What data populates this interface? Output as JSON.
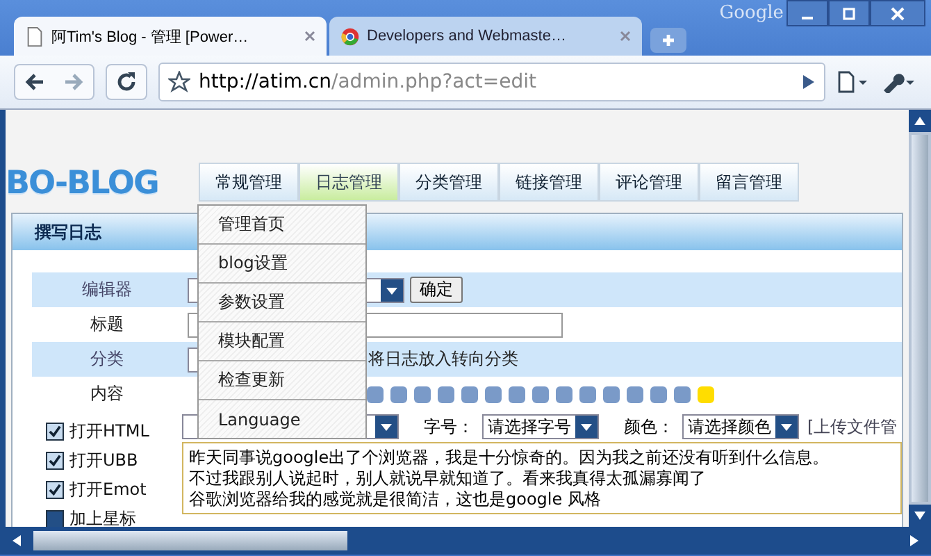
{
  "window": {
    "brand": "Google"
  },
  "tabs": [
    {
      "title": "阿Tim's Blog - 管理 [Power…",
      "kind": "page",
      "selected": true
    },
    {
      "title": "Developers and Webmaste…",
      "kind": "chrome",
      "selected": false
    }
  ],
  "toolbar": {
    "url_host": "http://atim.cn",
    "url_path": "/admin.php?act=edit"
  },
  "site": {
    "logo": "BO-BLOG"
  },
  "nav": [
    {
      "label": "常规管理",
      "selected": false
    },
    {
      "label": "日志管理",
      "selected": true
    },
    {
      "label": "分类管理",
      "selected": false
    },
    {
      "label": "链接管理",
      "selected": false
    },
    {
      "label": "评论管理",
      "selected": false
    },
    {
      "label": "留言管理",
      "selected": false
    }
  ],
  "menu": [
    "管理首页",
    "blog设置",
    "参数设置",
    "模块配置",
    "检查更新",
    "Language"
  ],
  "section": {
    "title": "撰写日志"
  },
  "form": {
    "editor_label": "编辑器",
    "confirm_button": "确定",
    "title_label": "标题",
    "category_label": "分类",
    "category_hint": "将日志放入转向分类",
    "content_label": "内容",
    "options": [
      {
        "label": "打开HTML",
        "checked": true
      },
      {
        "label": "打开UBB",
        "checked": true
      },
      {
        "label": "打开Emot",
        "checked": true
      },
      {
        "label": "加上星标",
        "checked": false
      }
    ],
    "size_label": "字号：",
    "size_select": "请选择字号",
    "color_label": "颜色：",
    "color_select": "请选择颜色",
    "upload_link": "[上传文件管",
    "content_lines": [
      "昨天同事说google出了个浏览器，我是十分惊奇的。因为我之前还没有听到什么信息。",
      "不过我跟别人说起时，别人就说早就知道了。看来我真得太孤漏寡闻了",
      "谷歌浏览器给我的感觉就是很简洁，这也是google 风格"
    ]
  }
}
